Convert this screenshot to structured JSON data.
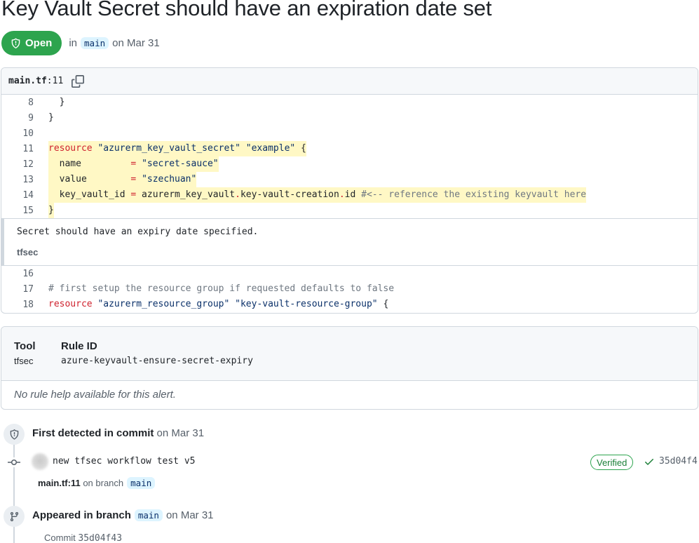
{
  "alert": {
    "title": "Key Vault Secret should have an expiration date set",
    "status": "Open",
    "in_label": "in",
    "branch": "main",
    "date_text": "on Mar 31"
  },
  "code_view": {
    "file": "main.tf",
    "line_ref": ":11",
    "lines_before": [
      {
        "num": "8",
        "text": "  }"
      },
      {
        "num": "9",
        "text": "}"
      },
      {
        "num": "10",
        "text": ""
      },
      {
        "num": "11",
        "tokens": [
          [
            "k",
            "resource"
          ],
          [
            "p",
            " "
          ],
          [
            "s",
            "\"azurerm_key_vault_secret\""
          ],
          [
            "p",
            " "
          ],
          [
            "s",
            "\"example\""
          ],
          [
            "p",
            " {"
          ]
        ]
      },
      {
        "num": "12",
        "tokens": [
          [
            "p",
            "  name         "
          ],
          [
            "k",
            "="
          ],
          [
            "p",
            " "
          ],
          [
            "s",
            "\"secret-sauce\""
          ]
        ]
      },
      {
        "num": "13",
        "tokens": [
          [
            "p",
            "  value        "
          ],
          [
            "k",
            "="
          ],
          [
            "p",
            " "
          ],
          [
            "s",
            "\"szechuan\""
          ]
        ]
      },
      {
        "num": "14",
        "tokens": [
          [
            "p",
            "  key_vault_id "
          ],
          [
            "k",
            "="
          ],
          [
            "p",
            " azurerm_key_vault"
          ],
          [
            "k",
            "."
          ],
          [
            "p",
            "key-vault-creation"
          ],
          [
            "k",
            "."
          ],
          [
            "p",
            "id "
          ],
          [
            "c",
            "#<-- reference the existing keyvault here"
          ]
        ]
      },
      {
        "num": "15",
        "tokens": [
          [
            "p",
            "}"
          ]
        ]
      }
    ],
    "alert_message": "Secret should have an expiry date specified.",
    "alert_tool": "tfsec",
    "lines_after": [
      {
        "num": "16",
        "tokens": []
      },
      {
        "num": "17",
        "tokens": [
          [
            "c",
            "# first setup the resource group if requested defaults to false"
          ]
        ]
      },
      {
        "num": "18",
        "tokens": [
          [
            "k",
            "resource"
          ],
          [
            "p",
            " "
          ],
          [
            "s",
            "\"azurerm_resource_group\""
          ],
          [
            "p",
            " "
          ],
          [
            "s",
            "\"key-vault-resource-group\""
          ],
          [
            "p",
            " {"
          ]
        ]
      }
    ]
  },
  "info": {
    "tool_label": "Tool",
    "tool_value": "tfsec",
    "rule_label": "Rule ID",
    "rule_value": "azure-keyvault-ensure-secret-expiry",
    "help_text": "No rule help available for this alert."
  },
  "timeline": {
    "detected_label": "First detected in commit",
    "detected_date": "on Mar 31",
    "commit_message": "new tfsec workflow test v5",
    "verified_label": "Verified",
    "commit_sha": "35d04f4",
    "commit_file": "main.tf:11",
    "on_branch_label": "on branch",
    "branch": "main",
    "appeared_label": "Appeared in branch",
    "appeared_branch": "main",
    "appeared_date": "on Mar 31",
    "commit_ref_label": "Commit",
    "commit_ref_sha": "35d04f43"
  },
  "colors": {
    "open_green": "#2da44e",
    "highlight_yellow": "#fff8c5",
    "keyword_red": "#cf222e",
    "string_blue": "#0a3069"
  },
  "icons": [
    "shield-icon",
    "copy-icon",
    "git-commit-icon",
    "check-icon",
    "git-branch-icon"
  ]
}
